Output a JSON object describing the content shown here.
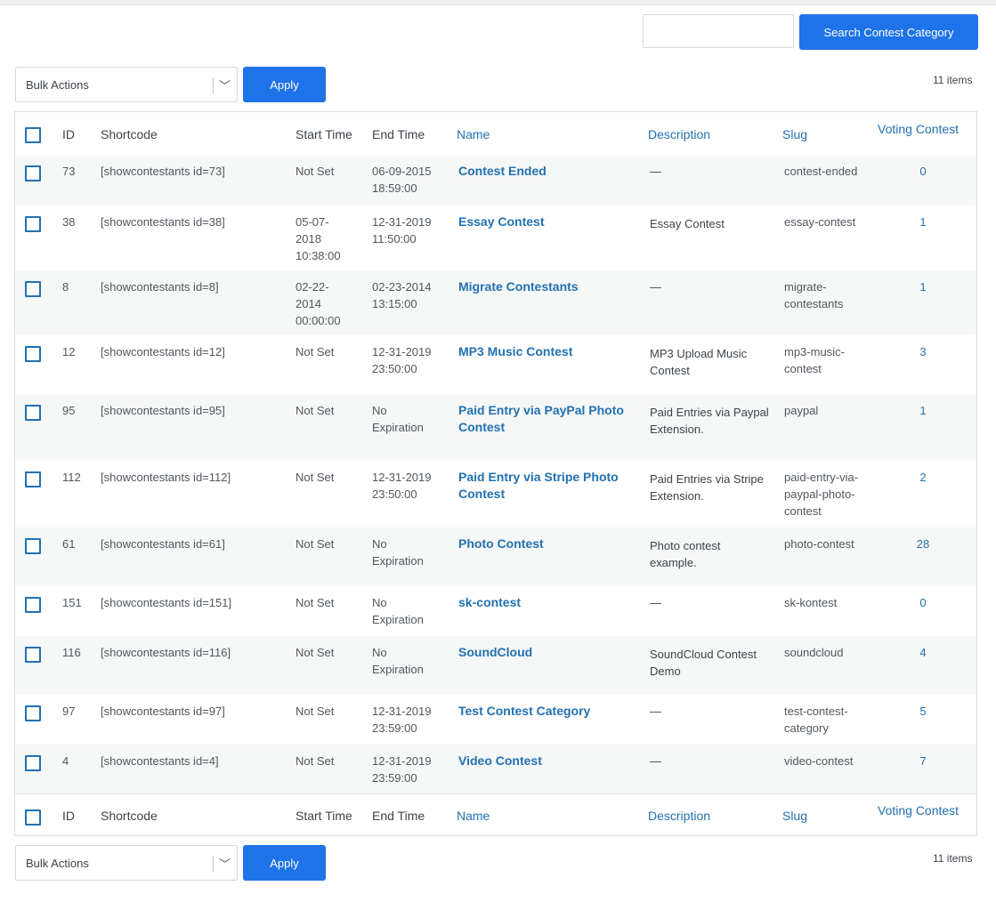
{
  "search": {
    "placeholder": "",
    "button_label": "Search Contest Category"
  },
  "bulk": {
    "top_label": "Bulk Actions",
    "bottom_label": "Bulk Actions",
    "apply_label": "Apply"
  },
  "items_count": "11 items",
  "columns": {
    "id": "ID",
    "shortcode": "Shortcode",
    "start_time": "Start Time",
    "end_time": "End Time",
    "name": "Name",
    "description": "Description",
    "slug": "Slug",
    "voting_contest": "Voting Contest"
  },
  "rows": [
    {
      "id": "73",
      "shortcode": "[showcontestants id=73]",
      "start": [
        "Not Set"
      ],
      "end": [
        "06-09-2015",
        "18:59:00"
      ],
      "name": [
        "Contest Ended"
      ],
      "desc": [
        "—"
      ],
      "slug": [
        "contest-ended"
      ],
      "count": "0"
    },
    {
      "id": "38",
      "shortcode": "[showcontestants id=38]",
      "start": [
        "05-07-",
        "2018",
        "10:38:00"
      ],
      "end": [
        "12-31-2019",
        "11:50:00"
      ],
      "name": [
        "Essay Contest"
      ],
      "desc": [
        "Essay Contest"
      ],
      "slug": [
        "essay-contest"
      ],
      "count": "1"
    },
    {
      "id": "8",
      "shortcode": "[showcontestants id=8]",
      "start": [
        "02-22-",
        "2014",
        "00:00:00"
      ],
      "end": [
        "02-23-2014",
        "13:15:00"
      ],
      "name": [
        "Migrate Contestants"
      ],
      "desc": [
        "—"
      ],
      "slug": [
        "migrate-",
        "contestants"
      ],
      "count": "1"
    },
    {
      "id": "12",
      "shortcode": "[showcontestants id=12]",
      "start": [
        "Not Set"
      ],
      "end": [
        "12-31-2019",
        "23:50:00"
      ],
      "name": [
        "MP3 Music Contest"
      ],
      "desc": [
        "MP3 Upload Music",
        "Contest"
      ],
      "slug": [
        "mp3-music-",
        "contest"
      ],
      "count": "3"
    },
    {
      "id": "95",
      "shortcode": "[showcontestants id=95]",
      "start": [
        "Not Set"
      ],
      "end": [
        "No",
        "Expiration"
      ],
      "name": [
        "Paid Entry via PayPal Photo",
        "Contest"
      ],
      "desc": [
        "Paid Entries via Paypal",
        "Extension."
      ],
      "slug": [
        "paypal"
      ],
      "count": "1"
    },
    {
      "id": "112",
      "shortcode": "[showcontestants id=112]",
      "start": [
        "Not Set"
      ],
      "end": [
        "12-31-2019",
        "23:50:00"
      ],
      "name": [
        "Paid Entry via Stripe Photo",
        "Contest"
      ],
      "desc": [
        "Paid Entries via Stripe",
        "Extension."
      ],
      "slug": [
        "paid-entry-via-",
        "paypal-photo-",
        "contest"
      ],
      "count": "2"
    },
    {
      "id": "61",
      "shortcode": "[showcontestants id=61]",
      "start": [
        "Not Set"
      ],
      "end": [
        "No",
        "Expiration"
      ],
      "name": [
        "Photo Contest"
      ],
      "desc": [
        "Photo contest",
        "example."
      ],
      "slug": [
        "photo-contest"
      ],
      "count": "28"
    },
    {
      "id": "151",
      "shortcode": "[showcontestants id=151]",
      "start": [
        "Not Set"
      ],
      "end": [
        "No",
        "Expiration"
      ],
      "name": [
        "sk-contest"
      ],
      "desc": [
        "—"
      ],
      "slug": [
        "sk-kontest"
      ],
      "count": "0"
    },
    {
      "id": "116",
      "shortcode": "[showcontestants id=116]",
      "start": [
        "Not Set"
      ],
      "end": [
        "No",
        "Expiration"
      ],
      "name": [
        "SoundCloud"
      ],
      "desc": [
        "SoundCloud Contest",
        "Demo"
      ],
      "slug": [
        "soundcloud"
      ],
      "count": "4"
    },
    {
      "id": "97",
      "shortcode": "[showcontestants id=97]",
      "start": [
        "Not Set"
      ],
      "end": [
        "12-31-2019",
        "23:59:00"
      ],
      "name": [
        "Test Contest Category"
      ],
      "desc": [
        "—"
      ],
      "slug": [
        "test-contest-",
        "category"
      ],
      "count": "5"
    },
    {
      "id": "4",
      "shortcode": "[showcontestants id=4]",
      "start": [
        "Not Set"
      ],
      "end": [
        "12-31-2019",
        "23:59:00"
      ],
      "name": [
        "Video Contest"
      ],
      "desc": [
        "—"
      ],
      "slug": [
        "video-contest"
      ],
      "count": "7"
    }
  ]
}
